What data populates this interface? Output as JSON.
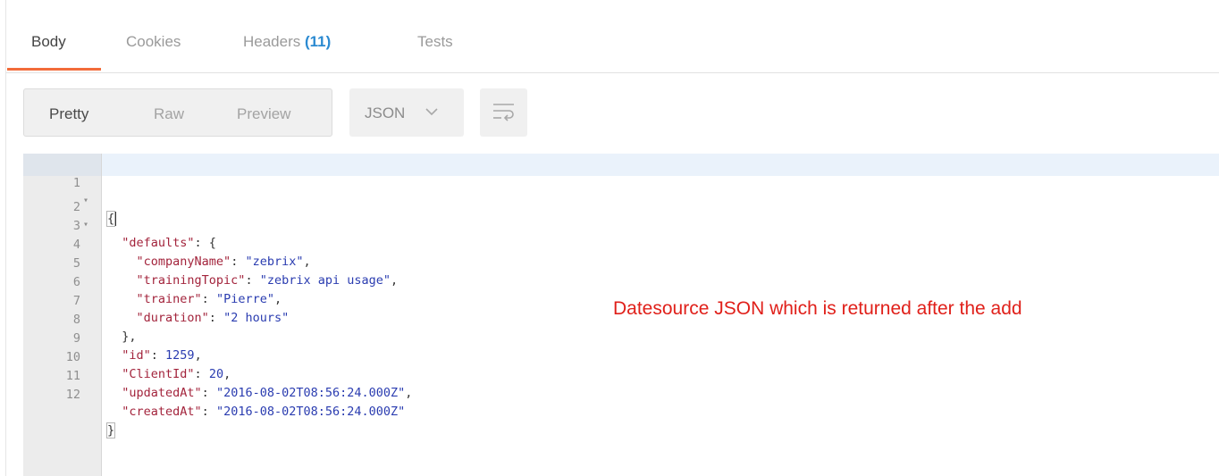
{
  "tabs": [
    {
      "label": "Body",
      "count": ""
    },
    {
      "label": "Cookies",
      "count": ""
    },
    {
      "label": "Headers",
      "count": "(11)"
    },
    {
      "label": "Tests",
      "count": ""
    }
  ],
  "toolbar": {
    "modes": [
      "Pretty",
      "Raw",
      "Preview"
    ],
    "format_select": "JSON",
    "wrap_icon": "wrap-lines-icon"
  },
  "editor": {
    "lines": [
      {
        "n": "1",
        "fold": "▾"
      },
      {
        "n": "2",
        "fold": "▾"
      },
      {
        "n": "3",
        "fold": ""
      },
      {
        "n": "4",
        "fold": ""
      },
      {
        "n": "5",
        "fold": ""
      },
      {
        "n": "6",
        "fold": ""
      },
      {
        "n": "7",
        "fold": ""
      },
      {
        "n": "8",
        "fold": ""
      },
      {
        "n": "9",
        "fold": ""
      },
      {
        "n": "10",
        "fold": ""
      },
      {
        "n": "11",
        "fold": ""
      },
      {
        "n": "12",
        "fold": ""
      }
    ],
    "open_brace": "{",
    "close_brace": "}",
    "defaults_key": "\"defaults\"",
    "open_obj": ": {",
    "company_key": "\"companyName\"",
    "company_val": "\"zebrix\"",
    "topic_key": "\"trainingTopic\"",
    "topic_val": "\"zebrix api usage\"",
    "trainer_key": "\"trainer\"",
    "trainer_val": "\"Pierre\"",
    "duration_key": "\"duration\"",
    "duration_val": "\"2 hours\"",
    "close_obj": "},",
    "id_key": "\"id\"",
    "id_val": "1259",
    "client_key": "\"ClientId\"",
    "client_val": "20",
    "updated_key": "\"updatedAt\"",
    "updated_val": "\"2016-08-02T08:56:24.000Z\"",
    "created_key": "\"createdAt\"",
    "created_val": "\"2016-08-02T08:56:24.000Z\""
  },
  "annotation": "Datesource JSON which is returned after the add",
  "colors": {
    "accent": "#f26b3a",
    "count": "#2b8ad1",
    "annotation": "#e0201a",
    "json_key": "#a3243c",
    "json_value": "#2a3cb0"
  }
}
